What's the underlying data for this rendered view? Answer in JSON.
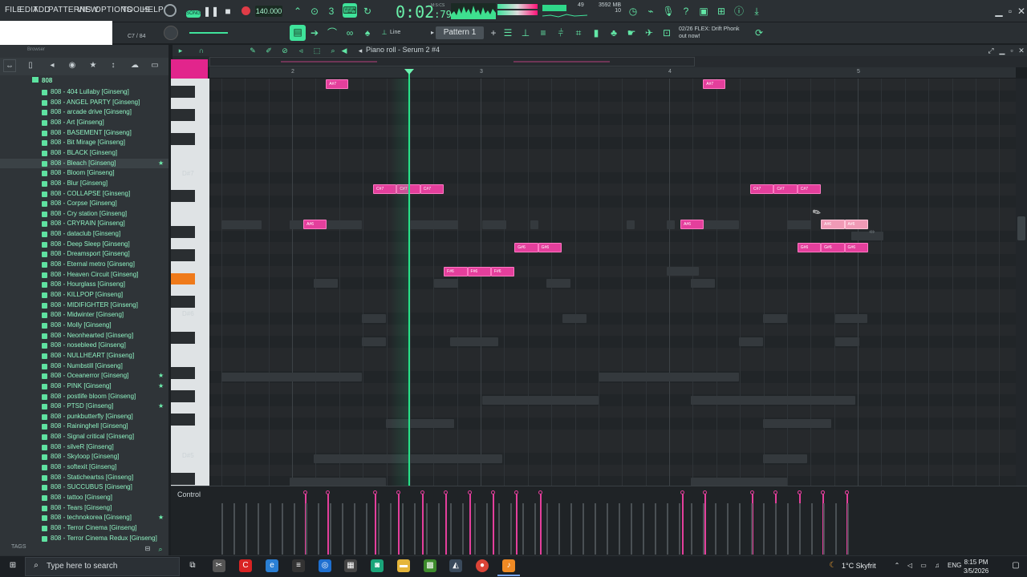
{
  "menu": [
    "FILE",
    "EDIT",
    "ADD",
    "PATTERNS",
    "VIEW",
    "OPTIONS",
    "TOOLS",
    "HELP"
  ],
  "transport": {
    "mode": "SONG",
    "tempo": "140.000",
    "time_main": "0:02",
    "time_frac": ":79",
    "time_unit": "M:S:CS",
    "cpu": "49",
    "mem": "3592 MB",
    "poly": "10"
  },
  "toolbar2": {
    "hint_number": "C7 / 84",
    "snap": "Line",
    "pattern": "Pattern 1",
    "news_line1": "02/26  FLEX: Drift Phonk",
    "news_line2": "out now!"
  },
  "browser": {
    "title": "Browser",
    "folder": "808",
    "tags_label": "TAGS",
    "items": [
      {
        "label": "808 - 404 Lullaby [Ginseng]",
        "star": false,
        "sel": false
      },
      {
        "label": "808 - ANGEL PARTY [Ginseng]",
        "star": false,
        "sel": false
      },
      {
        "label": "808 - arcade drive [Ginseng]",
        "star": false,
        "sel": false
      },
      {
        "label": "808 - Art [Ginseng]",
        "star": false,
        "sel": false
      },
      {
        "label": "808 - BASEMENT [Ginseng]",
        "star": false,
        "sel": false
      },
      {
        "label": "808 - Bit Mirage [Ginseng]",
        "star": false,
        "sel": false
      },
      {
        "label": "808 - BLACK [Ginseng]",
        "star": false,
        "sel": false
      },
      {
        "label": "808 - Bleach [Ginseng]",
        "star": true,
        "sel": true
      },
      {
        "label": "808 - Bloom [Ginseng]",
        "star": false,
        "sel": false
      },
      {
        "label": "808 - Blur [Ginseng]",
        "star": false,
        "sel": false
      },
      {
        "label": "808 - COLLAPSE [Ginseng]",
        "star": false,
        "sel": false
      },
      {
        "label": "808 - Corpse [Ginseng]",
        "star": false,
        "sel": false
      },
      {
        "label": "808 - Cry station [Ginseng]",
        "star": false,
        "sel": false
      },
      {
        "label": "808 - CRYRAIN [Ginseng]",
        "star": false,
        "sel": false
      },
      {
        "label": "808 - dataclub [Ginseng]",
        "star": false,
        "sel": false
      },
      {
        "label": "808 - Deep Sleep [Ginseng]",
        "star": false,
        "sel": false
      },
      {
        "label": "808 - Dreamsport [Ginseng]",
        "star": false,
        "sel": false
      },
      {
        "label": "808 - Eternal metro [Ginseng]",
        "star": false,
        "sel": false
      },
      {
        "label": "808 - Heaven Circuit [Ginseng]",
        "star": false,
        "sel": false
      },
      {
        "label": "808 - Hourglass [Ginseng]",
        "star": false,
        "sel": false
      },
      {
        "label": "808 - KILLPOP [Ginseng]",
        "star": false,
        "sel": false
      },
      {
        "label": "808 - MIDIFIGHTER [Ginseng]",
        "star": false,
        "sel": false
      },
      {
        "label": "808 - Midwinter [Ginseng]",
        "star": false,
        "sel": false
      },
      {
        "label": "808 - Molly [Ginseng]",
        "star": false,
        "sel": false
      },
      {
        "label": "808 - Neonhearted [Ginseng]",
        "star": false,
        "sel": false
      },
      {
        "label": "808 - nosebleed [Ginseng]",
        "star": false,
        "sel": false
      },
      {
        "label": "808 - NULLHEART [Ginseng]",
        "star": false,
        "sel": false
      },
      {
        "label": "808 - Numbstill [Ginseng]",
        "star": false,
        "sel": false
      },
      {
        "label": "808 - Oceanerror [Ginseng]",
        "star": true,
        "sel": false
      },
      {
        "label": "808 - PINK [Ginseng]",
        "star": true,
        "sel": false
      },
      {
        "label": "808 - postlife bloom [Ginseng]",
        "star": false,
        "sel": false
      },
      {
        "label": "808 - PTSD [Ginseng]",
        "star": true,
        "sel": false
      },
      {
        "label": "808 - punkbutterfly [Ginseng]",
        "star": false,
        "sel": false
      },
      {
        "label": "808 - Raininghell [Ginseng]",
        "star": false,
        "sel": false
      },
      {
        "label": "808 - Signal critical [Ginseng]",
        "star": false,
        "sel": false
      },
      {
        "label": "808 - silveR [Ginseng]",
        "star": false,
        "sel": false
      },
      {
        "label": "808 - Skyloop [Ginseng]",
        "star": false,
        "sel": false
      },
      {
        "label": "808 - softexit [Ginseng]",
        "star": false,
        "sel": false
      },
      {
        "label": "808 - Staticheartss [Ginseng]",
        "star": false,
        "sel": false
      },
      {
        "label": "808 - SUCCUBUS [Ginseng]",
        "star": false,
        "sel": false
      },
      {
        "label": "808 - tattoo [Ginseng]",
        "star": false,
        "sel": false
      },
      {
        "label": "808 - Tears [Ginseng]",
        "star": false,
        "sel": false
      },
      {
        "label": "808 - technokorea [Ginseng]",
        "star": true,
        "sel": false
      },
      {
        "label": "808 - Terror Cinema [Ginseng]",
        "star": false,
        "sel": false
      },
      {
        "label": "808 - Terror Cinema Redux [Ginseng]",
        "star": false,
        "sel": false
      }
    ]
  },
  "piano_roll": {
    "title": "Piano roll - Serum 2 #4",
    "bar_numbers": [
      "2",
      "3",
      "4",
      "5"
    ],
    "key_labels": [
      "D#7",
      "D#6",
      "D#5"
    ],
    "control_label": "Control"
  },
  "notes": [
    {
      "label": "A#7",
      "row": 0,
      "start": 1.18,
      "len": 0.12,
      "sel": false
    },
    {
      "label": "A#7",
      "row": 0,
      "start": 3.18,
      "len": 0.12,
      "sel": false
    },
    {
      "label": "C#7",
      "row": 9,
      "start": 1.43,
      "len": 0.125,
      "sel": false
    },
    {
      "label": "C#7",
      "row": 9,
      "start": 1.555,
      "len": 0.125,
      "sel": false
    },
    {
      "label": "C#7",
      "row": 9,
      "start": 1.68,
      "len": 0.125,
      "sel": false
    },
    {
      "label": "C#7",
      "row": 9,
      "start": 3.43,
      "len": 0.125,
      "sel": false
    },
    {
      "label": "C#7",
      "row": 9,
      "start": 3.555,
      "len": 0.125,
      "sel": false
    },
    {
      "label": "C#7",
      "row": 9,
      "start": 3.68,
      "len": 0.125,
      "sel": false
    },
    {
      "label": "A#6",
      "row": 12,
      "start": 1.06,
      "len": 0.125,
      "sel": false
    },
    {
      "label": "A#6",
      "row": 12,
      "start": 3.06,
      "len": 0.125,
      "sel": false
    },
    {
      "label": "A#6",
      "row": 12,
      "start": 3.805,
      "len": 0.125,
      "sel": true
    },
    {
      "label": "A#6",
      "row": 12,
      "start": 3.93,
      "len": 0.125,
      "sel": true
    },
    {
      "label": "G#6",
      "row": 14,
      "start": 2.18,
      "len": 0.125,
      "sel": false
    },
    {
      "label": "G#6",
      "row": 14,
      "start": 2.305,
      "len": 0.125,
      "sel": false
    },
    {
      "label": "G#6",
      "row": 14,
      "start": 3.68,
      "len": 0.125,
      "sel": false
    },
    {
      "label": "G#6",
      "row": 14,
      "start": 3.805,
      "len": 0.125,
      "sel": false
    },
    {
      "label": "G#6",
      "row": 14,
      "start": 3.93,
      "len": 0.125,
      "sel": false
    },
    {
      "label": "F#6",
      "row": 16,
      "start": 1.805,
      "len": 0.125,
      "sel": false
    },
    {
      "label": "F#6",
      "row": 16,
      "start": 1.93,
      "len": 0.125,
      "sel": false
    },
    {
      "label": "F#6",
      "row": 16,
      "start": 2.055,
      "len": 0.125,
      "sel": false
    }
  ],
  "taskbar": {
    "search_placeholder": "Type here to search",
    "weather": "1°C  Skyfrit",
    "lang": "ENG",
    "time": "8:15 PM",
    "date": "3/5/2026"
  }
}
